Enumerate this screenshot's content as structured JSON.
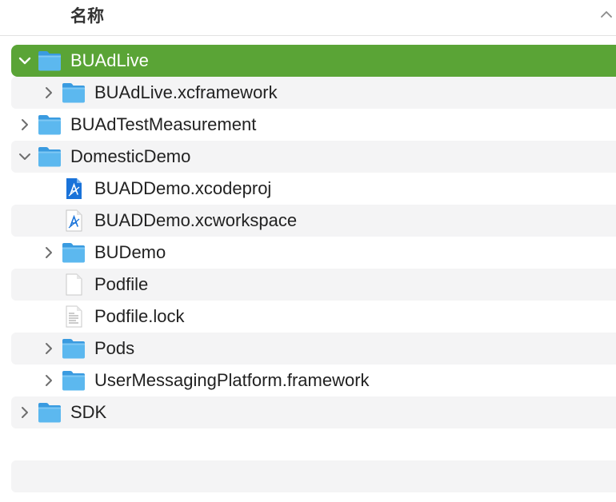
{
  "header": {
    "column_name": "名称",
    "sort_icon": "chevron-up-icon"
  },
  "colors": {
    "selection": "#5aa436",
    "folder": "#5cb8ef",
    "alternate_row": "#f4f4f5"
  },
  "rows": [
    {
      "label": "BUAdLive",
      "type": "folder",
      "depth": 0,
      "disclosure": "expanded",
      "selected": true
    },
    {
      "label": "BUAdLive.xcframework",
      "type": "folder",
      "depth": 1,
      "disclosure": "collapsed"
    },
    {
      "label": "BUAdTestMeasurement",
      "type": "folder",
      "depth": 0,
      "disclosure": "collapsed"
    },
    {
      "label": "DomesticDemo",
      "type": "folder",
      "depth": 0,
      "disclosure": "expanded"
    },
    {
      "label": "BUADDemo.xcodeproj",
      "type": "xcodeproj",
      "depth": 1,
      "disclosure": "none"
    },
    {
      "label": "BUADDemo.xcworkspace",
      "type": "xcworkspace",
      "depth": 1,
      "disclosure": "none"
    },
    {
      "label": "BUDemo",
      "type": "folder",
      "depth": 1,
      "disclosure": "collapsed"
    },
    {
      "label": "Podfile",
      "type": "file",
      "depth": 1,
      "disclosure": "none"
    },
    {
      "label": "Podfile.lock",
      "type": "text-file",
      "depth": 1,
      "disclosure": "none"
    },
    {
      "label": "Pods",
      "type": "folder",
      "depth": 1,
      "disclosure": "collapsed"
    },
    {
      "label": "UserMessagingPlatform.framework",
      "type": "folder",
      "depth": 1,
      "disclosure": "collapsed"
    },
    {
      "label": "SDK",
      "type": "folder",
      "depth": 0,
      "disclosure": "collapsed"
    }
  ]
}
